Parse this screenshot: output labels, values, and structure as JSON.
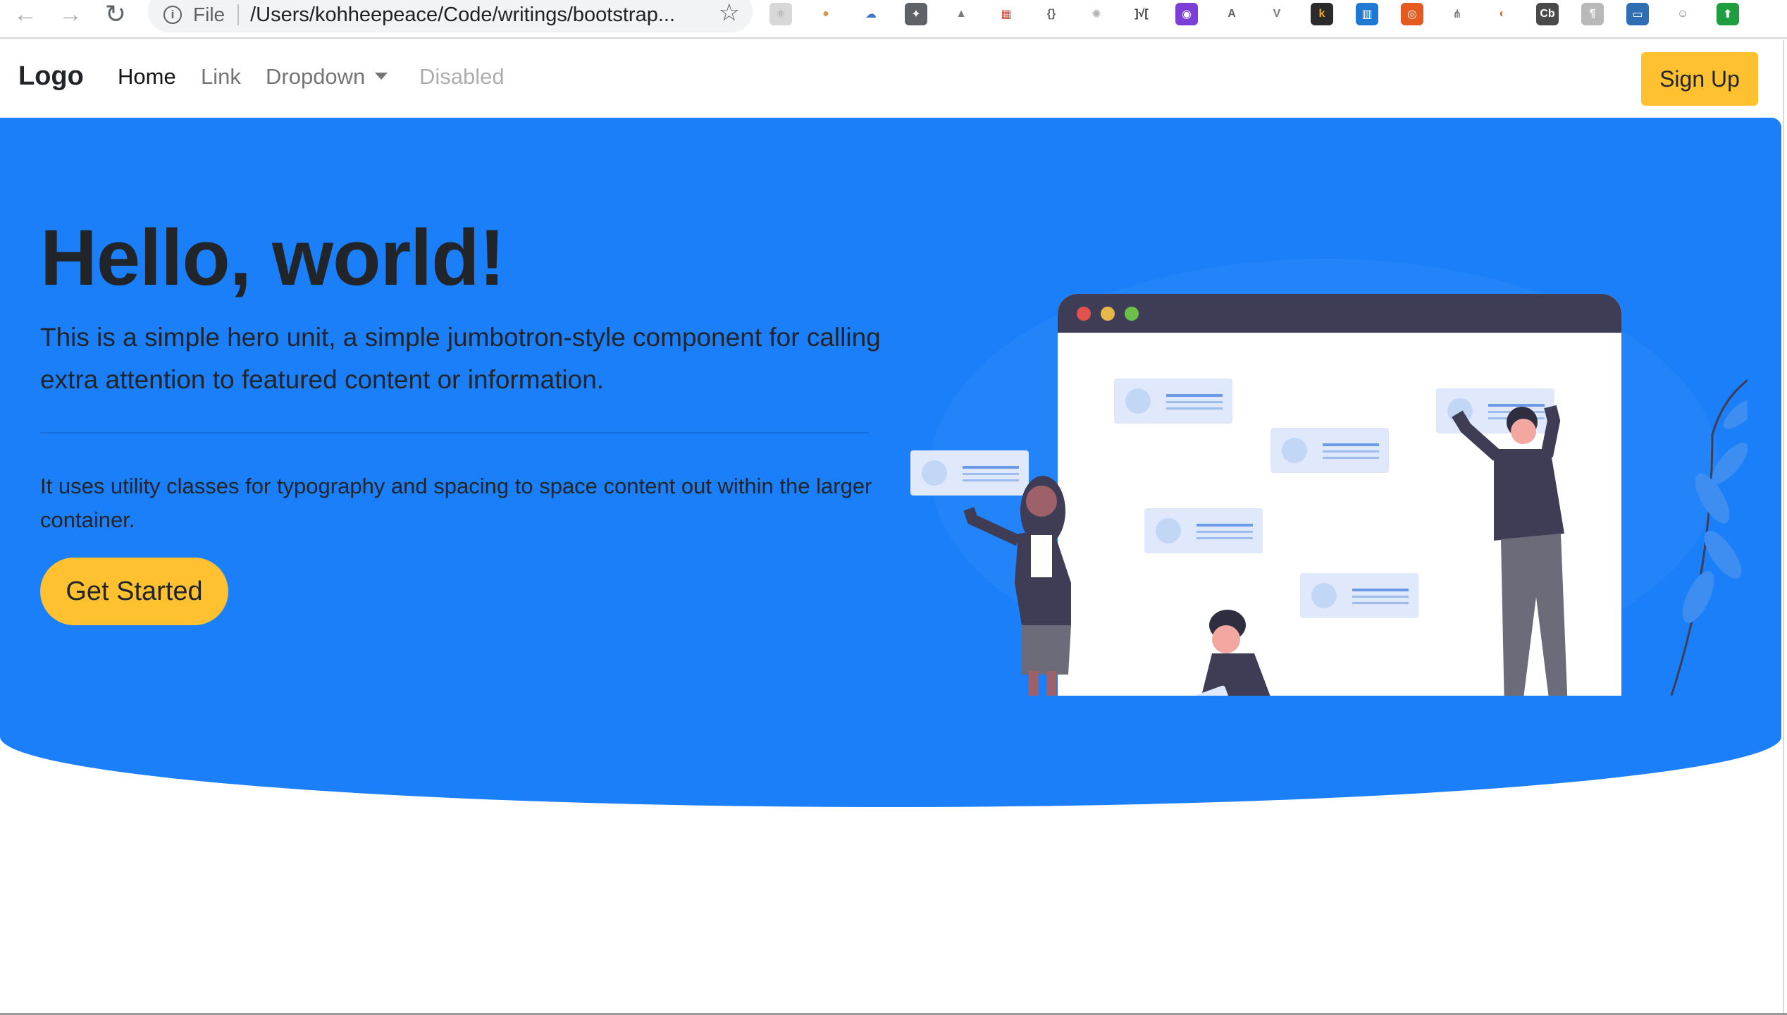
{
  "browser": {
    "back_glyph": "←",
    "forward_glyph": "→",
    "reload_glyph": "↻",
    "info_glyph": "i",
    "scheme_label": "File",
    "url": "/Users/kohheepeace/Code/writings/bootstrap...",
    "star_glyph": "☆",
    "extensions": [
      {
        "icon": "react-icon",
        "glyph": "⚛",
        "color": "#d8d8d8",
        "text_color": "#9aa0a6"
      },
      {
        "icon": "cookie-icon",
        "glyph": "●",
        "color": "#ffffff",
        "text_color": "#d19a4a"
      },
      {
        "icon": "cloud-icon",
        "glyph": "☁",
        "color": "#ffffff",
        "text_color": "#3b78c2"
      },
      {
        "icon": "lightbulb-icon",
        "glyph": "✦",
        "color": "#5f6368",
        "text_color": "#ffffff"
      },
      {
        "icon": "drive-icon",
        "glyph": "▲",
        "color": "#ffffff",
        "text_color": "#7a7a7a"
      },
      {
        "icon": "calendar-icon",
        "glyph": "▦",
        "color": "#ffffff",
        "text_color": "#c94a3a"
      },
      {
        "icon": "json-icon",
        "glyph": "{}",
        "color": "#ffffff",
        "text_color": "#5f6368"
      },
      {
        "icon": "gear-icon",
        "glyph": "✺",
        "color": "#ffffff",
        "text_color": "#b0b0b0"
      },
      {
        "icon": "bracket-icon",
        "glyph": "]√[",
        "color": "#ffffff",
        "text_color": "#333333"
      },
      {
        "icon": "colorpick-icon",
        "glyph": "◉",
        "color": "#7b3fd6",
        "text_color": "#ffffff"
      },
      {
        "icon": "a-icon",
        "glyph": "A",
        "color": "#ffffff",
        "text_color": "#5f6368"
      },
      {
        "icon": "vue-icon",
        "glyph": "V",
        "color": "#ffffff",
        "text_color": "#7a7a7a"
      },
      {
        "icon": "k-icon",
        "glyph": "k",
        "color": "#2b2b2b",
        "text_color": "#f5a623"
      },
      {
        "icon": "trello-icon",
        "glyph": "▥",
        "color": "#1f78d1",
        "text_color": "#ffffff"
      },
      {
        "icon": "eye-icon",
        "glyph": "◎",
        "color": "#e55a1f",
        "text_color": "#ffffff"
      },
      {
        "icon": "tree-icon",
        "glyph": "⋔",
        "color": "#ffffff",
        "text_color": "#7a7a7a"
      },
      {
        "icon": "swirl-icon",
        "glyph": "◐",
        "color": "#ffffff",
        "text_color": "#ee6a24"
      },
      {
        "icon": "cb-icon",
        "glyph": "Cb",
        "color": "#4a4a4a",
        "text_color": "#ffffff"
      },
      {
        "icon": "figure-icon",
        "glyph": "¶",
        "color": "#b9b9b9",
        "text_color": "#ffffff"
      },
      {
        "icon": "window-icon",
        "glyph": "▭",
        "color": "#2f6db5",
        "text_color": "#ffffff"
      },
      {
        "icon": "face-icon",
        "glyph": "☺",
        "color": "#ffffff",
        "text_color": "#7a7a7a"
      },
      {
        "icon": "upload-icon",
        "glyph": "⬆",
        "color": "#1e9e3e",
        "text_color": "#ffffff"
      }
    ]
  },
  "navbar": {
    "brand": "Logo",
    "links": {
      "home": "Home",
      "link": "Link",
      "dropdown": "Dropdown",
      "disabled": "Disabled"
    },
    "signup_label": "Sign Up"
  },
  "hero": {
    "title": "Hello, world!",
    "lead": "This is a simple hero unit, a simple jumbotron-style component for calling extra attention to featured content or information.",
    "body": "It uses utility classes for typography and spacing to space content out within the larger container.",
    "cta_label": "Get Started"
  },
  "colors": {
    "hero_bg": "#1a7ff8",
    "accent_yellow": "#ffc130",
    "text_dark": "#212529"
  }
}
